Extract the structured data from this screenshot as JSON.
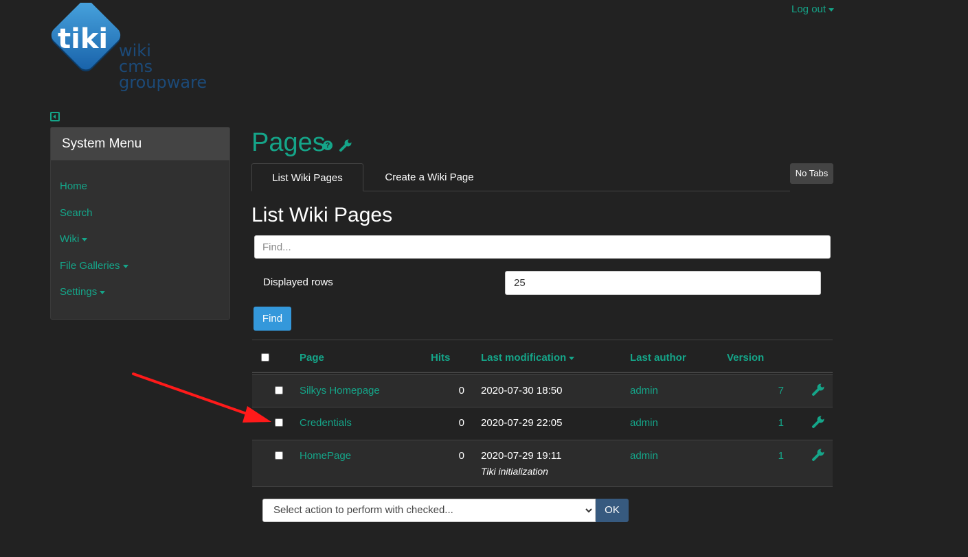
{
  "logo": {
    "letters": "tiki",
    "lines": [
      "wiki",
      "cms",
      "groupware"
    ]
  },
  "header": {
    "logout_label": "Log out"
  },
  "sidebar": {
    "title": "System Menu",
    "items": [
      {
        "label": "Home",
        "dropdown": false
      },
      {
        "label": "Search",
        "dropdown": false
      },
      {
        "label": "Wiki",
        "dropdown": true
      },
      {
        "label": "File Galleries",
        "dropdown": true
      },
      {
        "label": "Settings",
        "dropdown": true
      }
    ]
  },
  "page": {
    "title": "Pages",
    "help_glyph": "?"
  },
  "tabs": [
    {
      "label": "List Wiki Pages",
      "active": true
    },
    {
      "label": "Create a Wiki Page",
      "active": false
    }
  ],
  "no_tabs_label": "No Tabs",
  "section_title": "List Wiki Pages",
  "search": {
    "placeholder": "Find...",
    "value": ""
  },
  "displayed_rows": {
    "label": "Displayed rows",
    "value": "25"
  },
  "find_button": "Find",
  "table": {
    "columns": [
      "Page",
      "Hits",
      "Last modification",
      "Last author",
      "Version"
    ],
    "sorted_column": "Last modification",
    "rows": [
      {
        "page": "Silkys Homepage",
        "hits": "0",
        "modified": "2020-07-30 18:50",
        "comment": "",
        "author": "admin",
        "version": "7"
      },
      {
        "page": "Credentials",
        "hits": "0",
        "modified": "2020-07-29 22:05",
        "comment": "",
        "author": "admin",
        "version": "1"
      },
      {
        "page": "HomePage",
        "hits": "0",
        "modified": "2020-07-29 19:11",
        "comment": "Tiki initialization",
        "author": "admin",
        "version": "1"
      }
    ]
  },
  "bulk_action": {
    "selected": "Select action to perform with checked...",
    "ok_label": "OK"
  },
  "colors": {
    "accent": "#15a589",
    "background": "#222222",
    "find_button": "#3498db",
    "ok_button": "#375a7f",
    "annotation_arrow": "#ff1a1a"
  }
}
